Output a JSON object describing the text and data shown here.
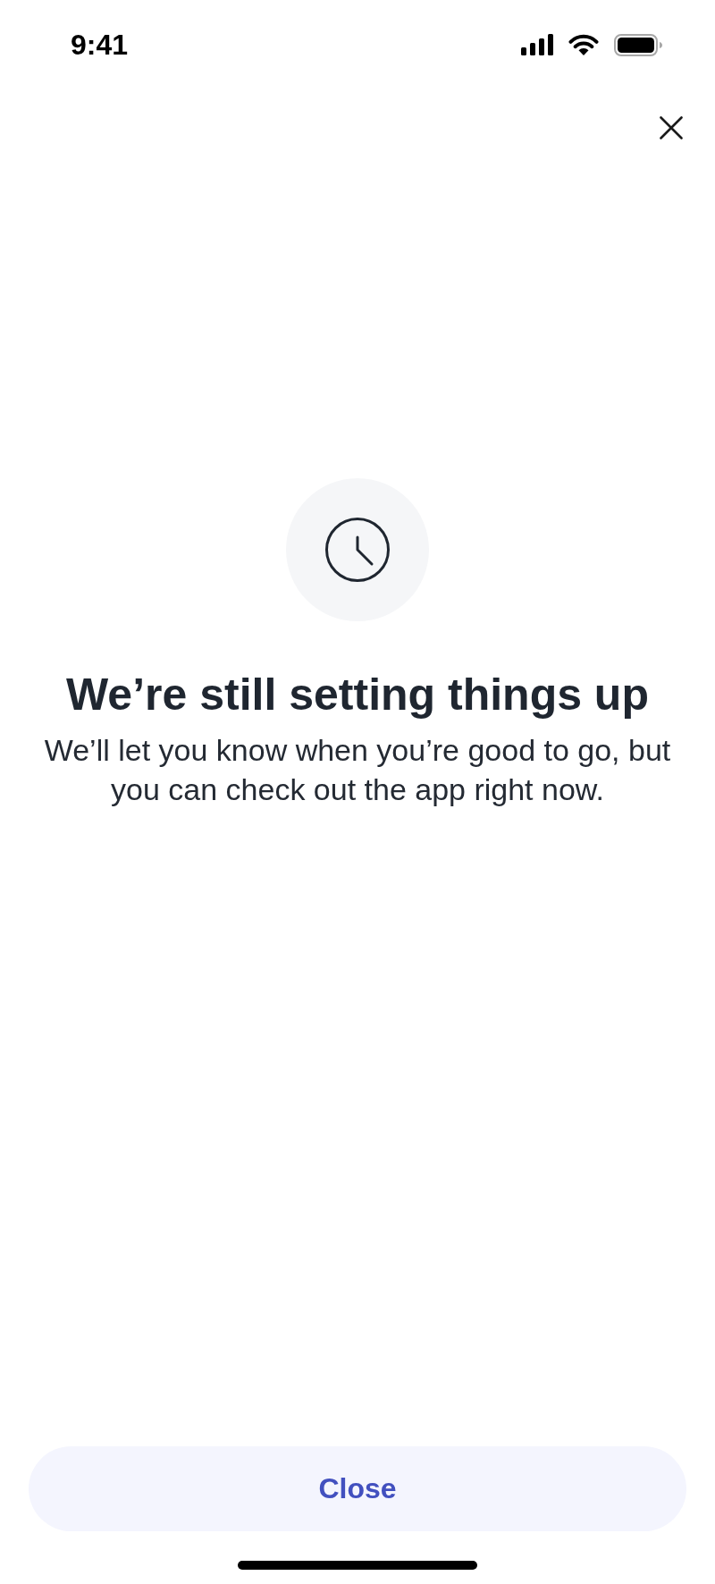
{
  "status_bar": {
    "time": "9:41"
  },
  "notice": {
    "title": "We’re still setting things up",
    "message": "We’ll let you know when you’re good to go, but you can check out the app right now."
  },
  "footer_button": {
    "label": "Close"
  }
}
